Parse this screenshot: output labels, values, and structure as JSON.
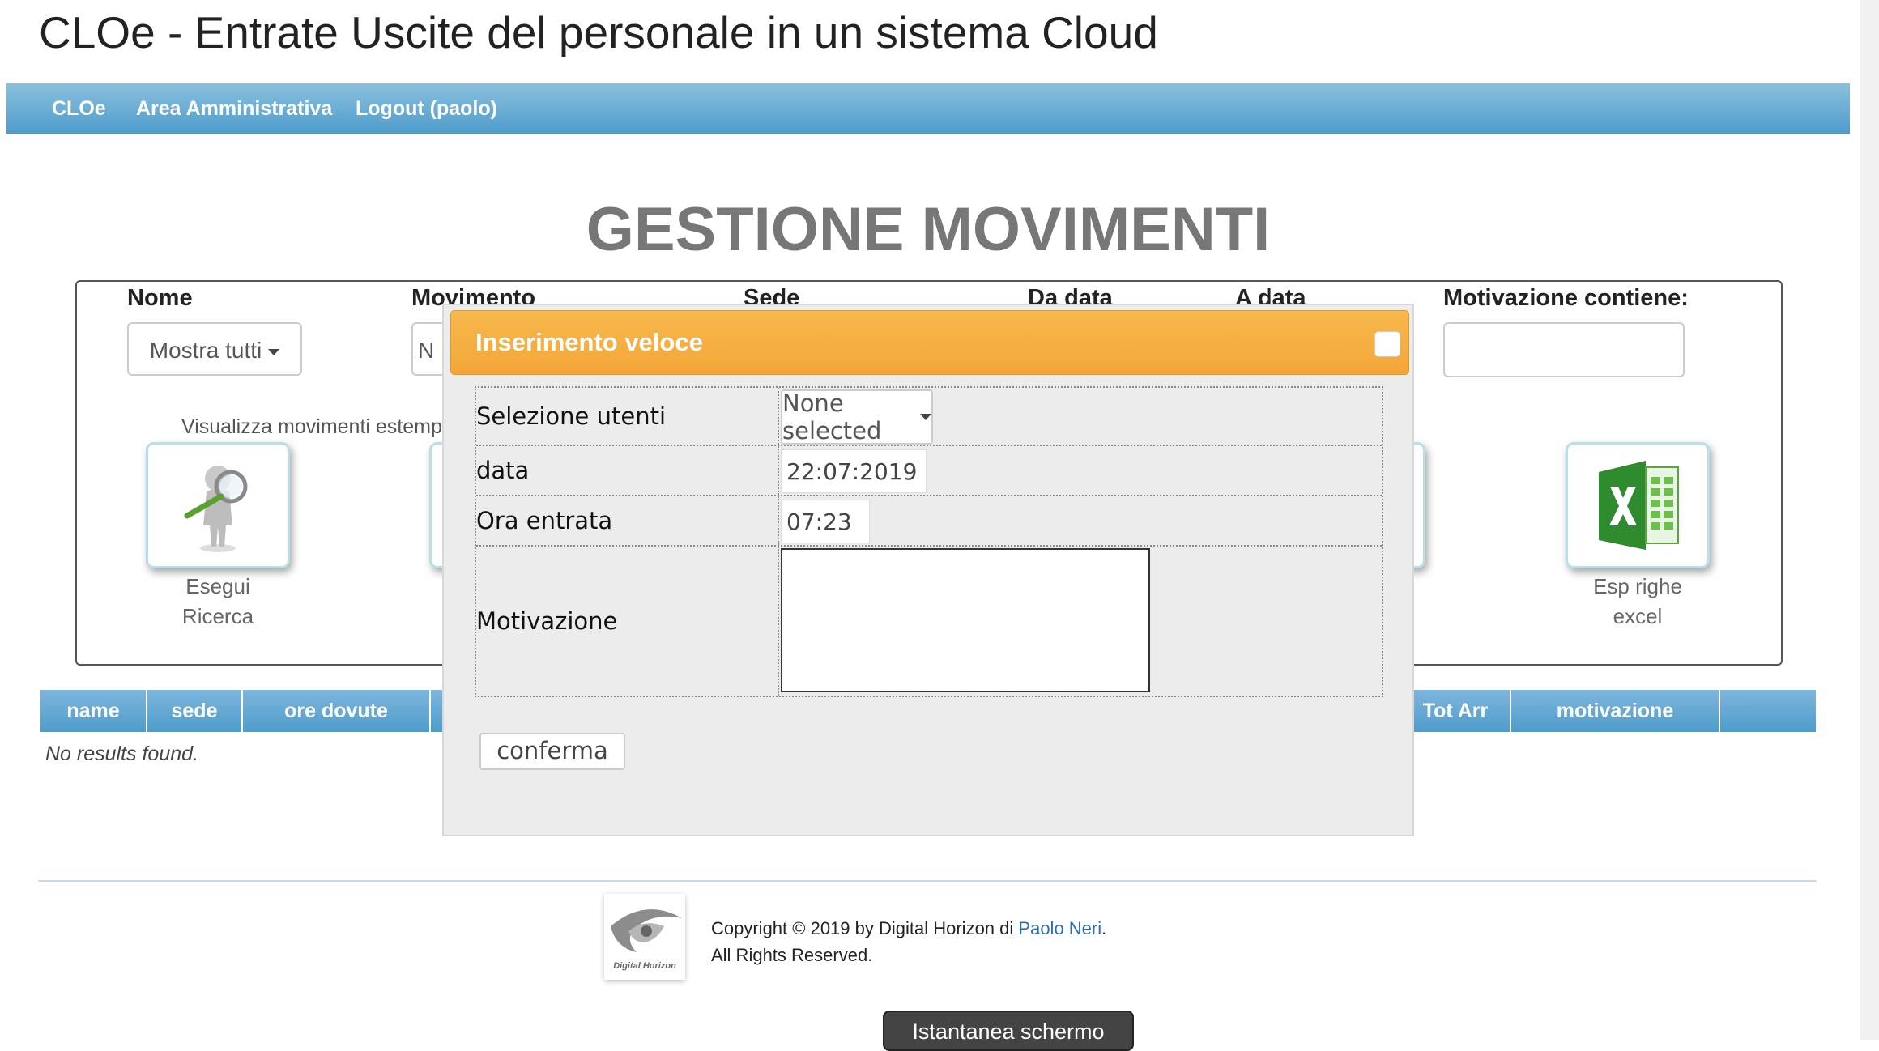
{
  "app": {
    "title": "CLOe - Entrate Uscite del personale in un sistema Cloud"
  },
  "nav": {
    "items": [
      {
        "label": "CLOe"
      },
      {
        "label": "Area Amministrativa"
      },
      {
        "label": "Logout (paolo)"
      }
    ]
  },
  "page": {
    "heading": "GESTIONE MOVIMENTI"
  },
  "filters": {
    "nome_label": "Nome",
    "nome_value": "Mostra tutti",
    "movimento_label": "Movimento",
    "movimento_fragment": "N",
    "sede_label": "Sede",
    "da_data_label": "Da data",
    "a_data_label": "A data",
    "motivazione_label": "Motivazione contiene:",
    "motivazione_value": "",
    "visualizza_note": "Visualizza movimenti estemporanei"
  },
  "actions": {
    "search_line1": "Esegui",
    "search_line2": "Ricerca",
    "export_line1": "Esp righe",
    "export_line2": "excel",
    "search_icon": "magnifier-man-icon",
    "export_icon": "excel-icon"
  },
  "table": {
    "columns": [
      "name",
      "sede",
      "ore dovute",
      "Tot Arr",
      "motivazione"
    ],
    "empty_text": "No results found."
  },
  "dialog": {
    "title": "Inserimento veloce",
    "utenti_label": "Selezione utenti",
    "utenti_value": "None selected",
    "data_label": "data",
    "data_value": "22:07:2019",
    "ora_label": "Ora entrata",
    "ora_value": "07:23",
    "motivazione_label": "Motivazione",
    "motivazione_value": "",
    "confirm_label": "conferma",
    "header_color": "#f4a637"
  },
  "footer": {
    "copyright_prefix": "Copyright © 2019 by Digital Horizon di ",
    "author_link": "Paolo Neri",
    "copyright_suffix": ".",
    "rights": "All Rights Reserved.",
    "logo_text": "Digital Horizon"
  },
  "floating": {
    "screenshot_button": "Istantanea schermo"
  },
  "colors": {
    "nav_blue": "#4f9ccb",
    "link_blue": "#2a6ebb",
    "heading_gray": "#777777"
  }
}
